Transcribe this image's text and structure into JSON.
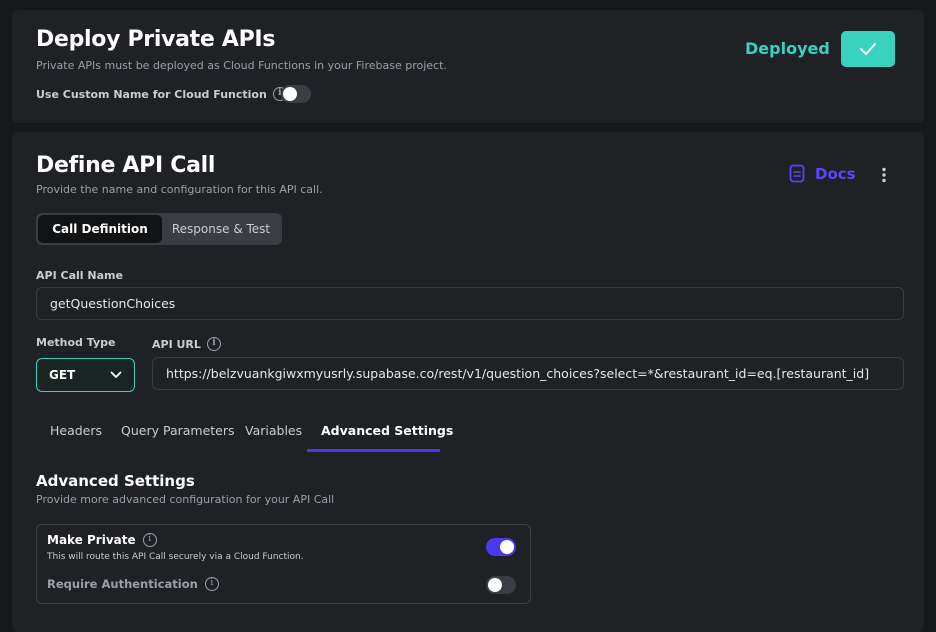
{
  "deploy": {
    "title": "Deploy Private APIs",
    "subtitle": "Private APIs must be deployed as Cloud Functions in your Firebase project.",
    "custom_name_label": "Use Custom Name for Cloud Function",
    "custom_name_enabled": false,
    "status": "Deployed"
  },
  "define": {
    "title": "Define API Call",
    "subtitle": "Provide the name and configuration for this API call.",
    "docs_label": "Docs",
    "tabs": [
      {
        "label": "Call Definition",
        "active": true
      },
      {
        "label": "Response & Test",
        "active": false
      }
    ],
    "api_call_name_label": "API Call Name",
    "api_call_name_value": "getQuestionChoices",
    "method_type_label": "Method Type",
    "method_value": "GET",
    "api_url_label": "API URL",
    "api_url_value": "https://belzvuankgiwxmyusrly.supabase.co/rest/v1/question_choices?select=*&restaurant_id=eq.[restaurant_id]",
    "subtabs": [
      {
        "label": "Headers",
        "active": false
      },
      {
        "label": "Query Parameters",
        "active": false
      },
      {
        "label": "Variables",
        "active": false
      },
      {
        "label": "Advanced Settings",
        "active": true
      }
    ]
  },
  "advanced": {
    "title": "Advanced Settings",
    "subtitle": "Provide more advanced configuration for your API Call",
    "make_private_label": "Make Private",
    "make_private_desc": "This will route this API Call securely via a Cloud Function.",
    "make_private_enabled": true,
    "require_auth_label": "Require Authentication",
    "require_auth_enabled": false
  },
  "colors": {
    "accent_teal": "#39d2c0",
    "accent_purple": "#4b39ef",
    "docs_purple": "#5a45ff"
  },
  "icons": [
    "check-icon",
    "info-icon",
    "document-icon",
    "more-vertical-icon",
    "chevron-down-icon"
  ]
}
